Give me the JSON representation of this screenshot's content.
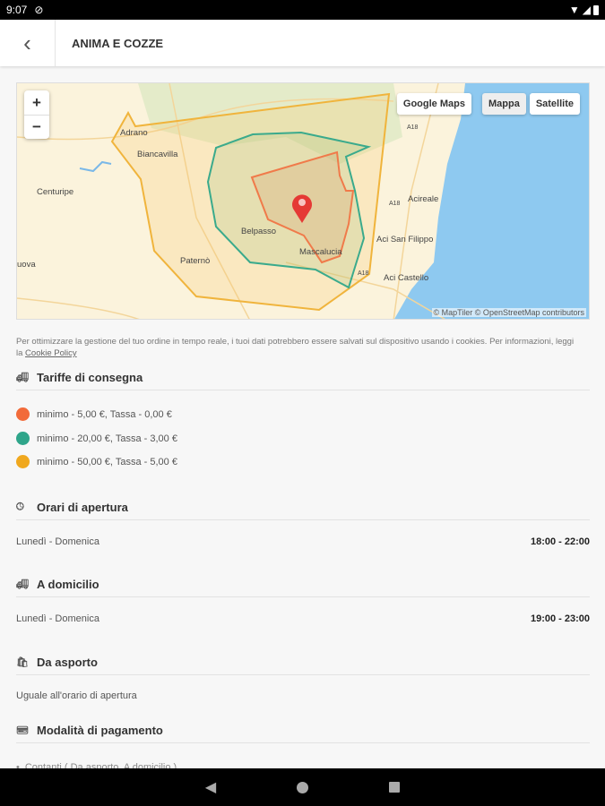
{
  "status": {
    "time": "9:07"
  },
  "appbar": {
    "title": "ANIMA E COZZE"
  },
  "map": {
    "zoom_in": "+",
    "zoom_out": "−",
    "buttons": [
      "Google Maps",
      "Mappa",
      "Satellite"
    ],
    "selected": "Mappa",
    "attribution": "© MapTiler © OpenStreetMap contributors",
    "places": [
      "Adrano",
      "Biancavilla",
      "Centuripe",
      "Belpasso",
      "Paternò",
      "Mascalucia",
      "Acireale",
      "Aci San Filippo",
      "Aci Castello",
      "uova"
    ],
    "roads": [
      "A18",
      "A18",
      "A18"
    ],
    "zone_colors": {
      "orange": "#f07a4a",
      "green": "#3aaa8c",
      "yellow": "#f0b43c"
    }
  },
  "cookie": {
    "text": "Per ottimizzare la gestione del tuo ordine in tempo reale, i tuoi dati potrebbero essere salvati sul dispositivo usando i cookies. Per informazioni, leggi la ",
    "link": "Cookie Policy"
  },
  "fees": {
    "title": "Tariffe di consegna",
    "items": [
      {
        "label": "minimo - 5,00 €, Tassa - 0,00 €",
        "color": "#f26b3a"
      },
      {
        "label": "minimo - 20,00 €, Tassa - 3,00 €",
        "color": "#2fa58a"
      },
      {
        "label": "minimo - 50,00 €, Tassa - 5,00 €",
        "color": "#f0a81e"
      }
    ]
  },
  "opening": {
    "title": "Orari di apertura",
    "days": "Lunedì - Domenica",
    "hours": "18:00 - 22:00"
  },
  "delivery": {
    "title": "A domicilio",
    "days": "Lunedì - Domenica",
    "hours": "19:00 - 23:00"
  },
  "takeaway": {
    "title": "Da asporto",
    "text": "Uguale all'orario di apertura"
  },
  "payment": {
    "title": "Modalità di pagamento",
    "items": [
      "Contanti ( Da asporto, A domicilio )"
    ]
  }
}
